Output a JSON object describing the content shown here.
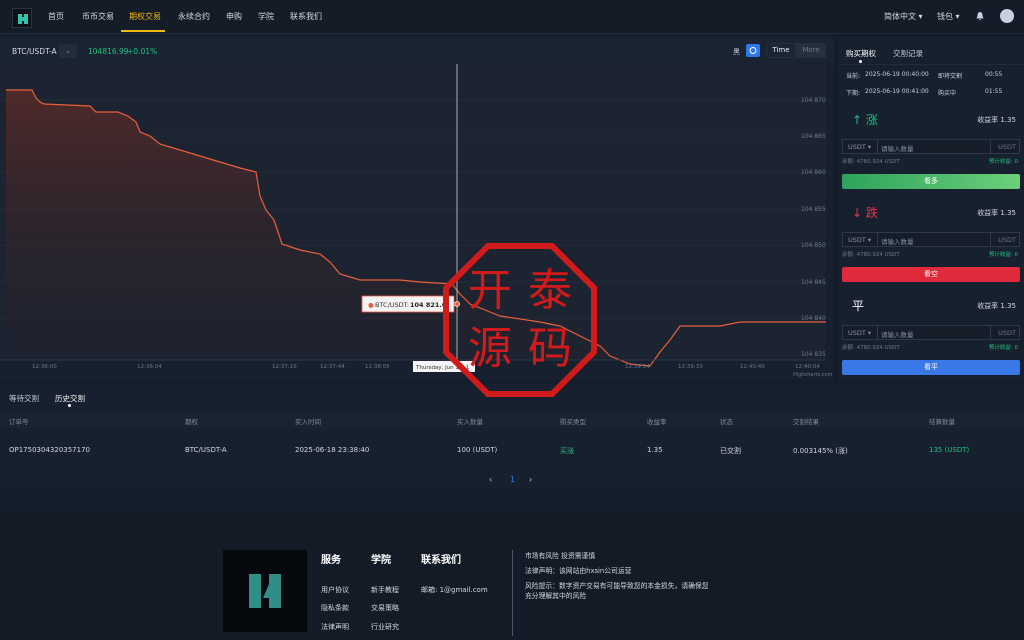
{
  "nav": {
    "items": [
      "首页",
      "币币交易",
      "期权交易",
      "永续合约",
      "申购",
      "学院",
      "联系我们"
    ],
    "active_index": 2,
    "language": "简体中文",
    "wallet": "钱包"
  },
  "chart_header": {
    "pair": "BTC/USDT-A",
    "price": "104816.99",
    "change": "+0.01%",
    "theme_label": "黑",
    "time_label": "Time",
    "more_label": "More"
  },
  "chart_data": {
    "type": "line",
    "y_ticks": [
      "104 870",
      "104 865",
      "104 860",
      "104 855",
      "104 850",
      "104 845",
      "104 840",
      "104 835"
    ],
    "x_ticks": [
      "12:36:00",
      "12:36:04",
      "12:37:16",
      "12:37:44",
      "12:38:05",
      "12:39:14",
      "12:39:33",
      "12:40:40",
      "12:40:04"
    ],
    "tooltip_label": "BTC/USDT:",
    "tooltip_value": "104 821.0",
    "crosshair_label": "Thursday, Jun 19, 1",
    "credits": "Highcharts.com",
    "line_color": "#e8603c"
  },
  "trade_panel": {
    "tabs": [
      "购买期权",
      "交割记录"
    ],
    "current_label": "当前:",
    "current_time": "2025-06-19 00:40:00",
    "current_status": "即将交割",
    "current_count": "00:55",
    "next_label": "下期:",
    "next_time": "2025-06-19 00:41:00",
    "next_status": "购买中",
    "next_count": "01:55",
    "sections": [
      {
        "title": "↑ 涨",
        "rate": "收益率 1.35",
        "currency": "USDT",
        "placeholder": "请输入数量",
        "unit": "USDT",
        "balance": "余额: 4780.924 USDT",
        "estimate": "预计收益: 0",
        "button": "看多",
        "color": "#3fb56a",
        "title_color": "#20c07c"
      },
      {
        "title": "↓ 跌",
        "rate": "收益率 1.35",
        "currency": "USDT",
        "placeholder": "请输入数量",
        "unit": "USDT",
        "balance": "余额: 4780.924 USDT",
        "estimate": "预计收益: 0",
        "button": "看空",
        "color": "#e0293a",
        "title_color": "#e5364a"
      },
      {
        "title": "平",
        "rate": "收益率 1.35",
        "currency": "USDT",
        "placeholder": "请输入数量",
        "unit": "USDT",
        "balance": "余额: 4780.924 USDT",
        "estimate": "预计收益: 0",
        "button": "看平",
        "color": "#3b78e7",
        "title_color": "#ffffff"
      }
    ]
  },
  "orders": {
    "tabs": [
      "等待交割",
      "历史交割"
    ],
    "headers": [
      "订单号",
      "期权",
      "买入时间",
      "买入数量",
      "购买类型",
      "收益率",
      "状态",
      "交割结果",
      "结算数量"
    ],
    "row": [
      "OP1750304320357170",
      "BTC/USDT-A",
      "2025-06-18 23:38:40",
      "100 (USDT)",
      "买涨",
      "1.35",
      "已交割",
      "0.003145% (涨)",
      "135 (USDT)"
    ],
    "page": "1"
  },
  "footer": {
    "cols": [
      {
        "title": "服务",
        "links": [
          "用户协议",
          "隐私条款",
          "法律声明"
        ]
      },
      {
        "title": "学院",
        "links": [
          "新手教程",
          "交易策略",
          "行业研究"
        ]
      },
      {
        "title": "联系我们",
        "links": [
          "邮箱: 1@gmail.com"
        ]
      }
    ],
    "notes": [
      "市场有风险 投资需谨慎",
      "法律声明：该网站由hxsin公司运营",
      "风险提示：数字资产交易有可能导致您的本金损失，请确保您充分理解其中的风险"
    ]
  },
  "watermark": "开泰源码"
}
